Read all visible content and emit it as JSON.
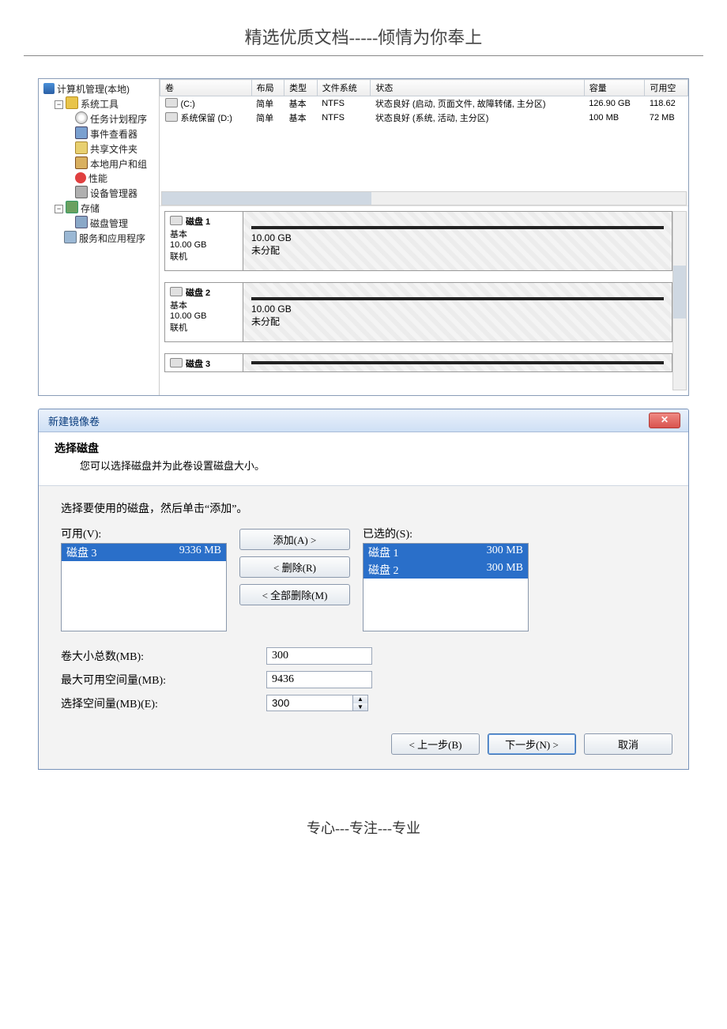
{
  "doc": {
    "header": "精选优质文档-----倾情为你奉上",
    "footer": "专心---专注---专业"
  },
  "tree": {
    "root": "计算机管理(本地)",
    "sys_tools": "系统工具",
    "task": "任务计划程序",
    "event": "事件查看器",
    "share": "共享文件夹",
    "users": "本地用户和组",
    "perf": "性能",
    "devmgr": "设备管理器",
    "storage": "存储",
    "diskmgmt": "磁盘管理",
    "services": "服务和应用程序"
  },
  "columns": {
    "vol": "卷",
    "layout": "布局",
    "type": "类型",
    "fs": "文件系统",
    "status": "状态",
    "cap": "容量",
    "free": "可用空"
  },
  "volumes": [
    {
      "name": "(C:)",
      "layout": "简单",
      "type": "基本",
      "fs": "NTFS",
      "status": "状态良好 (启动, 页面文件, 故障转储, 主分区)",
      "cap": "126.90 GB",
      "free": "118.62"
    },
    {
      "name": "系统保留 (D:)",
      "layout": "简单",
      "type": "基本",
      "fs": "NTFS",
      "status": "状态良好 (系统, 活动, 主分区)",
      "cap": "100 MB",
      "free": "72 MB"
    }
  ],
  "disks": [
    {
      "title": "磁盘 1",
      "type": "基本",
      "size": "10.00 GB",
      "state": "联机",
      "part_size": "10.00 GB",
      "part_state": "未分配"
    },
    {
      "title": "磁盘 2",
      "type": "基本",
      "size": "10.00 GB",
      "state": "联机",
      "part_size": "10.00 GB",
      "part_state": "未分配"
    },
    {
      "title": "磁盘 3",
      "type": "",
      "size": "",
      "state": "",
      "part_size": "",
      "part_state": ""
    }
  ],
  "wizard": {
    "title": "新建镜像卷",
    "heading": "选择磁盘",
    "subheading": "您可以选择磁盘并为此卷设置磁盘大小。",
    "instruction": "选择要使用的磁盘，然后单击“添加”。",
    "available_label": "可用(V):",
    "selected_label": "已选的(S):",
    "available": [
      {
        "name": "磁盘 3",
        "size": "9336 MB"
      }
    ],
    "selected": [
      {
        "name": "磁盘 1",
        "size": "300 MB"
      },
      {
        "name": "磁盘 2",
        "size": "300 MB"
      }
    ],
    "btn_add": "添加(A) >",
    "btn_remove": "< 删除(R)",
    "btn_remove_all": "< 全部删除(M)",
    "lbl_total": "卷大小总数(MB):",
    "val_total": "300",
    "lbl_max": "最大可用空间量(MB):",
    "val_max": "9436",
    "lbl_sel": "选择空间量(MB)(E):",
    "val_sel": "300",
    "btn_back": "< 上一步(B)",
    "btn_next": "下一步(N) >",
    "btn_cancel": "取消"
  }
}
